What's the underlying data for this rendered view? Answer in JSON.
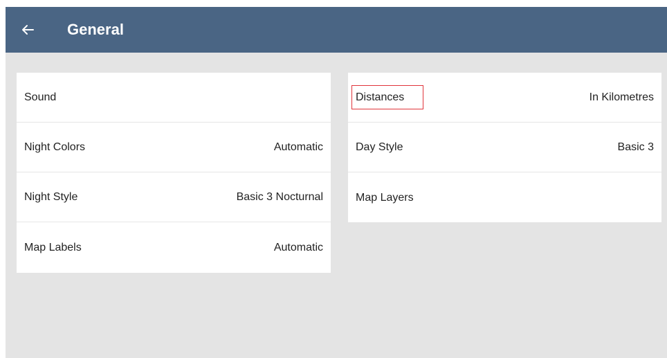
{
  "header": {
    "title": "General",
    "back_icon": "arrow-left-icon",
    "background_color": "#4a6584"
  },
  "left_settings": [
    {
      "label": "Sound",
      "value": ""
    },
    {
      "label": "Night Colors",
      "value": "Automatic"
    },
    {
      "label": "Night Style",
      "value": "Basic 3 Nocturnal"
    },
    {
      "label": "Map Labels",
      "value": "Automatic"
    }
  ],
  "right_settings": [
    {
      "label": "Distances",
      "value": "In Kilometres"
    },
    {
      "label": "Day Style",
      "value": "Basic 3"
    },
    {
      "label": "Map Layers",
      "value": ""
    }
  ],
  "highlight": {
    "target": "Distances",
    "color": "#e0343a"
  }
}
